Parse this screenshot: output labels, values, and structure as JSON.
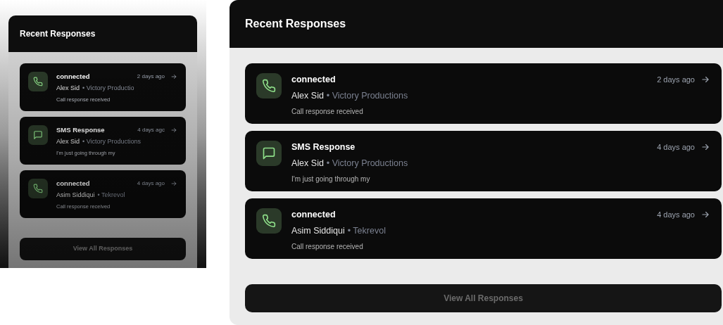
{
  "panels": [
    {
      "kind": "compact",
      "title": "Recent Responses",
      "items": [
        {
          "kind": "call",
          "title": "connected",
          "time": "2 days ago",
          "name": "Alex Sid",
          "company": "• Victory Productio",
          "snippet": "Call response received"
        },
        {
          "kind": "sms",
          "title": "SMS Response",
          "time": "4 days agc",
          "name": "Alex Sid",
          "company": "• Victory Productions",
          "snippet": "I'm just going through my"
        },
        {
          "kind": "call",
          "title": "connected",
          "time": "4 days ago",
          "name": "Asim Siddiqui",
          "company": "• Tekrevol",
          "snippet": "Call response received"
        }
      ],
      "button": "View All Responses"
    },
    {
      "kind": "full",
      "title": "Recent Responses",
      "items": [
        {
          "kind": "call",
          "title": "connected",
          "time": "2 days ago",
          "name": "Alex Sid",
          "company": "• Victory Productions",
          "snippet": "Call response received"
        },
        {
          "kind": "sms",
          "title": "SMS Response",
          "time": "4 days ago",
          "name": "Alex Sid",
          "company": "• Victory Productions",
          "snippet": "I'm just going through my"
        },
        {
          "kind": "call",
          "title": "connected",
          "time": "4 days ago",
          "name": "Asim Siddiqui",
          "company": "• Tekrevol",
          "snippet": "Call response received"
        }
      ],
      "button": "View All Responses"
    }
  ]
}
